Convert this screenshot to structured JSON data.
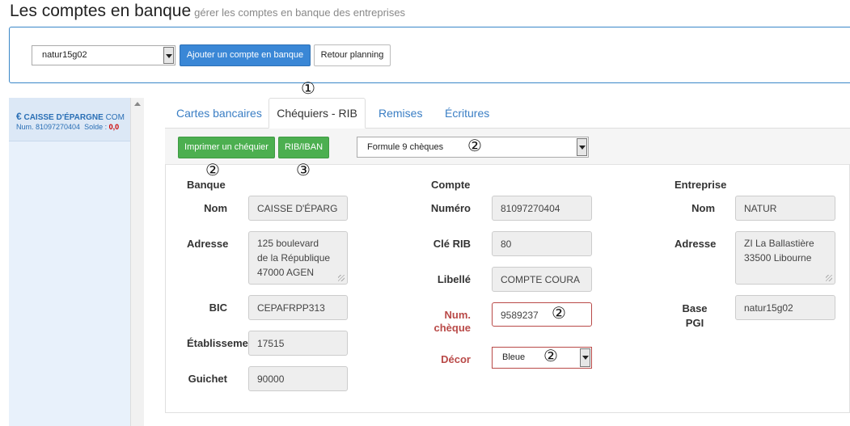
{
  "header": {
    "title": "Les comptes en banque",
    "subtitle": "gérer les comptes en banque des entreprises"
  },
  "toolbar_top": {
    "company_select": "natur15g02",
    "add_account_label": "Ajouter un compte en banque",
    "back_label": "Retour planning"
  },
  "sidebar": {
    "account_name": "CAISSE D'ÉPARGNE",
    "account_name_cut": "COM",
    "account_number": "Num. 81097270404",
    "balance_label": "Solde :",
    "balance_value": "0,0"
  },
  "tabs": [
    {
      "label": "Cartes bancaires"
    },
    {
      "label": "Chéquiers - RIB"
    },
    {
      "label": "Remises"
    },
    {
      "label": "Écritures"
    }
  ],
  "actions": {
    "print_label": "Imprimer un chéquier",
    "rib_label": "RIB/IBAN",
    "formula_select": "Formule 9 chèques"
  },
  "annotations": {
    "one": "①",
    "two": "②",
    "three": "③"
  },
  "banque": {
    "heading": "Banque",
    "nom_label": "Nom",
    "nom_value": "CAISSE D'ÉPARG",
    "adresse_label": "Adresse",
    "adresse_value": "125 boulevard\nde la République\n47000 AGEN",
    "bic_label": "BIC",
    "bic_value": "CEPAFRPP313",
    "etab_label": "Établisseme",
    "etab_value": "17515",
    "guichet_label": "Guichet",
    "guichet_value": "90000"
  },
  "compte": {
    "heading": "Compte",
    "numero_label": "Numéro",
    "numero_value": "81097270404",
    "cle_label": "Clé RIB",
    "cle_value": "80",
    "libelle_label": "Libellé",
    "libelle_value": "COMPTE COURA",
    "numcheque_label_1": "Num.",
    "numcheque_label_2": "chèque",
    "numcheque_value": "9589237",
    "decor_label": "Décor",
    "decor_value": "Bleue"
  },
  "entreprise": {
    "heading": "Entreprise",
    "nom_label": "Nom",
    "nom_value": "NATUR",
    "adresse_label": "Adresse",
    "adresse_value": "ZI La Ballastière\n33500 Libourne",
    "base_label_1": "Base",
    "base_label_2": "PGI",
    "base_value": "natur15g02"
  },
  "colors": {
    "accent": "#3a87d6",
    "green": "#4caf50",
    "error": "#b94a48"
  }
}
